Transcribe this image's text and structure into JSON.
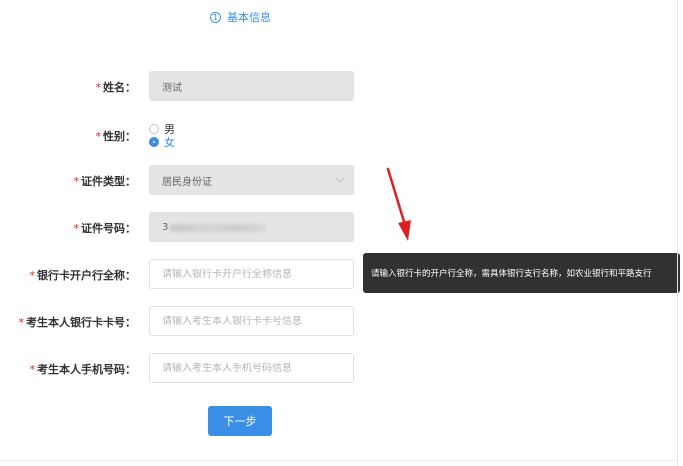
{
  "step": {
    "number": "1",
    "label": "基本信息"
  },
  "form": {
    "name": {
      "label": "姓名：",
      "value": "测试"
    },
    "gender": {
      "label": "性别：",
      "options": [
        "男",
        "女"
      ],
      "selected": "女"
    },
    "id_type": {
      "label": "证件类型：",
      "value": "居民身份证"
    },
    "id_number": {
      "label": "证件号码：",
      "value_visible": "3"
    },
    "bank_branch": {
      "label": "银行卡开户行全称：",
      "placeholder": "请输入银行卡开户行全称信息"
    },
    "bank_card": {
      "label": "考生本人银行卡卡号：",
      "placeholder": "请输入考生本人银行卡卡号信息"
    },
    "phone": {
      "label": "考生本人手机号码：",
      "placeholder": "请输入考生本人手机号码信息"
    },
    "required_mark": "*"
  },
  "tooltip": {
    "text": "请输入银行卡的开户行全称，需具体银行支行名称，如农业银行和平路支行"
  },
  "buttons": {
    "next": "下一步"
  },
  "colors": {
    "accent": "#3a8ee6",
    "required": "#e02020",
    "annotation_arrow": "#e02020",
    "tooltip_bg": "#303133"
  }
}
